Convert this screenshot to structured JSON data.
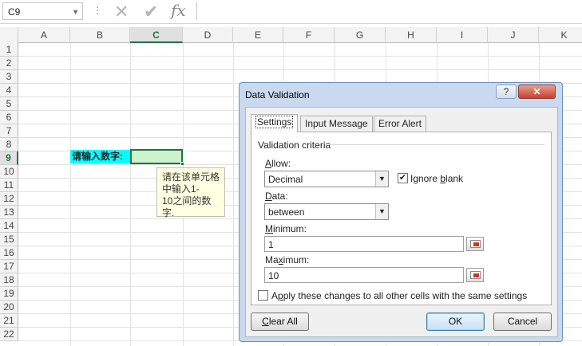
{
  "formula_bar": {
    "name_box": "C9",
    "formula": "",
    "icons": [
      "more-options-icon",
      "cancel-icon",
      "enter-icon",
      "insert-function-icon"
    ],
    "fx_label": "fx"
  },
  "grid": {
    "columns": [
      "A",
      "B",
      "C",
      "D",
      "E",
      "F",
      "G",
      "H",
      "I",
      "J",
      "K"
    ],
    "rows": [
      "1",
      "2",
      "3",
      "4",
      "5",
      "6",
      "7",
      "8",
      "9",
      "10",
      "11",
      "12",
      "13",
      "14",
      "15",
      "16",
      "17",
      "18",
      "19",
      "20",
      "21",
      "22"
    ],
    "selected_column": "C",
    "selected_row": "9",
    "cell_b9": "请输入数字:",
    "cell_b9_fill": "#00FFFF",
    "cell_c9_fill": "#CCF2CC",
    "input_tip": "请在该单元格\n中输入1-\n10之间的数字."
  },
  "dialog": {
    "title": "Data Validation",
    "help": "?",
    "close": "✕",
    "tabs": [
      "Settings",
      "Input Message",
      "Error Alert"
    ],
    "active_tab": "Settings",
    "group_label": "Validation criteria",
    "allow_label": "Allow:",
    "allow_value": "Decimal",
    "ignore_blank_label": "Ignore blank",
    "ignore_blank_checked": true,
    "data_label": "Data:",
    "data_value": "between",
    "minimum_label": "Minimum:",
    "minimum_value": "1",
    "maximum_label": "Maximum:",
    "maximum_value": "10",
    "apply_all_label": "Apply these changes to all other cells with the same settings",
    "apply_all_checked": false,
    "clear_all": "Clear All",
    "ok": "OK",
    "cancel": "Cancel",
    "accent": "#217346"
  }
}
